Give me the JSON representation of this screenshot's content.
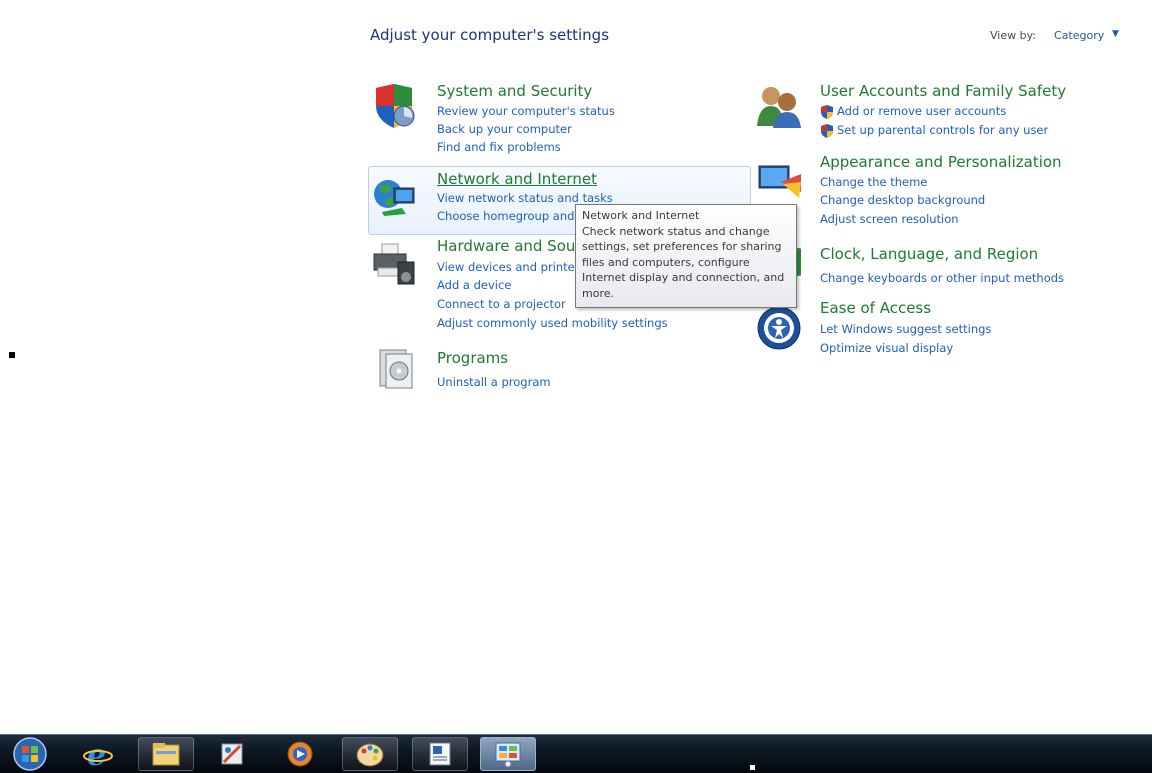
{
  "header": {
    "title": "Adjust your computer's settings",
    "view_by_label": "View by:",
    "view_by_value": "Category"
  },
  "categories": {
    "system_security": {
      "title": "System and Security",
      "links": [
        "Review your computer's status",
        "Back up your computer",
        "Find and fix problems"
      ]
    },
    "network_internet": {
      "title": "Network and Internet",
      "links": [
        "View network status and tasks",
        "Choose homegroup and"
      ]
    },
    "hardware_sound": {
      "title": "Hardware and Sou",
      "links": [
        "View devices and printe",
        "Add a device",
        "Connect to a projector",
        "Adjust commonly used mobility settings"
      ]
    },
    "programs": {
      "title": "Programs",
      "links": [
        "Uninstall a program"
      ]
    },
    "user_accounts": {
      "title": "User Accounts and Family Safety",
      "links": [
        "Add or remove user accounts",
        "Set up parental controls for any user"
      ]
    },
    "appearance": {
      "title": "Appearance and Personalization",
      "links": [
        "Change the theme",
        "Change desktop background",
        "Adjust screen resolution"
      ]
    },
    "clock_region": {
      "title": "Clock, Language, and Region",
      "links": [
        "Change keyboards or other input methods"
      ]
    },
    "ease_access": {
      "title": "Ease of Access",
      "links": [
        "Let Windows suggest settings",
        "Optimize visual display"
      ]
    }
  },
  "tooltip": {
    "lines": [
      "Network and Internet",
      "Check network status and change",
      "settings, set preferences for sharing",
      "files and computers, configure",
      "Internet display and connection, and",
      "more."
    ]
  },
  "taskbar": {
    "items": [
      "start-orb",
      "internet-explorer-icon",
      "windows-explorer-icon",
      "paint-icon",
      "media-player-icon",
      "paint-palette-icon",
      "wordpad-icon",
      "control-panel-icon"
    ]
  },
  "colors": {
    "category_title": "#1f7a32",
    "link": "#1e5fc0",
    "header": "#1e3287"
  }
}
